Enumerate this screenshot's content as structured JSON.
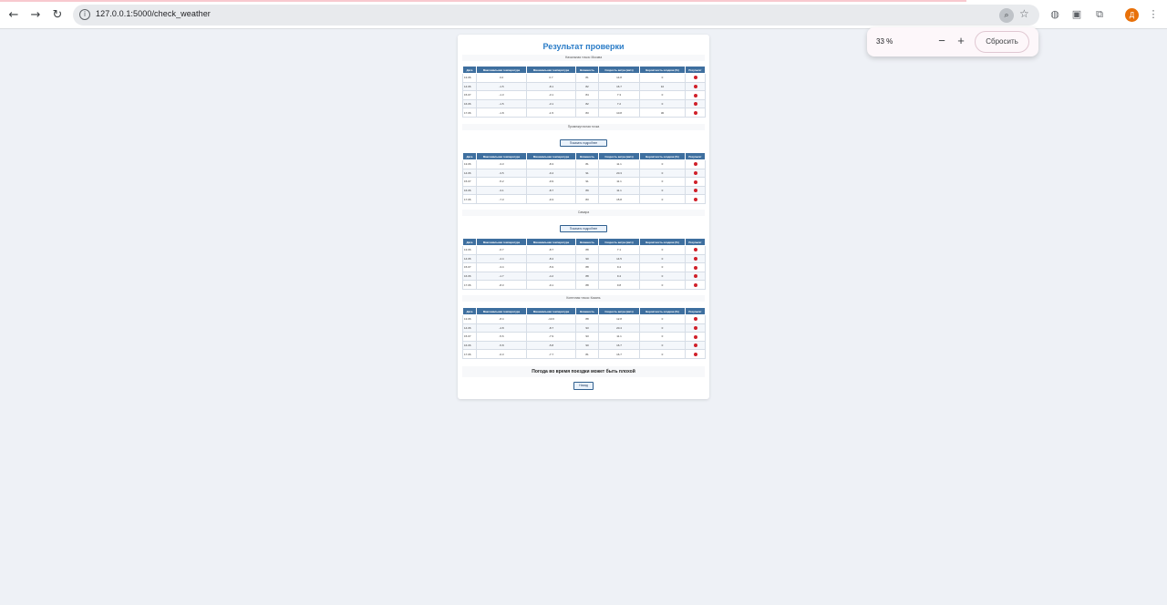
{
  "browser": {
    "url": "127.0.0.1:5000/check_weather",
    "avatar_letter": "Д",
    "zoom": {
      "value": "33 %",
      "minus": "−",
      "plus": "+",
      "reset": "Сбросить"
    }
  },
  "page": {
    "title": "Результат проверки",
    "details_button": "Показать подробнее",
    "final_message": "Погода во время поездки может быть плохой",
    "back_button": "Назад",
    "columns": [
      "Дата",
      "Максимальная температура",
      "Минимальная температура",
      "Влажность",
      "Скорость ветра (км/ч)",
      "Вероятность осадков (%)",
      "Результат"
    ],
    "points": [
      {
        "title": "Начальная точка: Москва",
        "rows": [
          {
            "date": "13.06",
            "tmax": "3.2",
            "tmin": "0.7",
            "humidity": "81",
            "wind": "14.8",
            "precip": "0"
          },
          {
            "date": "14.06",
            "tmax": "-1.5",
            "tmin": "-8.1",
            "humidity": "82",
            "wind": "16.7",
            "precip": "10"
          },
          {
            "date": "15.07",
            "tmax": "-1.3",
            "tmin": "-3.1",
            "humidity": "84",
            "wind": "7.3",
            "precip": "0"
          },
          {
            "date": "16.06",
            "tmax": "-1.5",
            "tmin": "-3.1",
            "humidity": "82",
            "wind": "7.2",
            "precip": "0"
          },
          {
            "date": "17.06",
            "tmax": "-1.8",
            "tmin": "-1.5",
            "humidity": "83",
            "wind": "10.8",
            "precip": "30"
          }
        ],
        "show_button": true
      },
      {
        "title": "Промежуточная точка",
        "rows": [
          {
            "date": "13.06",
            "tmax": "-3.3",
            "tmin": "-8.3",
            "humidity": "81",
            "wind": "11.1",
            "precip": "0"
          },
          {
            "date": "14.06",
            "tmax": "-3.5",
            "tmin": "-9.4",
            "humidity": "91",
            "wind": "20.3",
            "precip": "0"
          },
          {
            "date": "15.07",
            "tmax": "-5.2",
            "tmin": "-9.9",
            "humidity": "91",
            "wind": "11.1",
            "precip": "0"
          },
          {
            "date": "16.06",
            "tmax": "-3.1",
            "tmin": "-8.7",
            "humidity": "89",
            "wind": "11.1",
            "precip": "0"
          },
          {
            "date": "17.06",
            "tmax": "-7.3",
            "tmin": "-9.3",
            "humidity": "83",
            "wind": "15.8",
            "precip": "0"
          }
        ],
        "show_button": true
      },
      {
        "title": "Самара",
        "rows": [
          {
            "date": "13.06",
            "tmax": "-6.7",
            "tmin": "-8.7",
            "humidity": "88",
            "wind": "7.1",
            "precip": "0"
          },
          {
            "date": "14.06",
            "tmax": "-4.4",
            "tmin": "-8.4",
            "humidity": "90",
            "wind": "14.5",
            "precip": "0"
          },
          {
            "date": "15.07",
            "tmax": "-3.4",
            "tmin": "-5.9",
            "humidity": "88",
            "wind": "9.4",
            "precip": "0"
          },
          {
            "date": "16.06",
            "tmax": "-1.7",
            "tmin": "-4.2",
            "humidity": "88",
            "wind": "9.4",
            "precip": "0"
          },
          {
            "date": "17.06",
            "tmax": "-8.3",
            "tmin": "-9.1",
            "humidity": "88",
            "wind": "9.8",
            "precip": "0"
          }
        ],
        "show_button": false
      },
      {
        "title": "Конечная точка: Казань",
        "rows": [
          {
            "date": "13.06",
            "tmax": "-8.4",
            "tmin": "-10.6",
            "humidity": "88",
            "wind": "12.8",
            "precip": "0"
          },
          {
            "date": "14.06",
            "tmax": "-4.8",
            "tmin": "-8.7",
            "humidity": "93",
            "wind": "20.4",
            "precip": "0"
          },
          {
            "date": "15.07",
            "tmax": "-5.6",
            "tmin": "-7.9",
            "humidity": "93",
            "wind": "11.1",
            "precip": "0"
          },
          {
            "date": "16.06",
            "tmax": "-5.8",
            "tmin": "-5.8",
            "humidity": "90",
            "wind": "16.7",
            "precip": "0"
          },
          {
            "date": "17.06",
            "tmax": "-6.3",
            "tmin": "-7.7",
            "humidity": "81",
            "wind": "16.7",
            "precip": "0"
          }
        ],
        "show_button": false
      }
    ],
    "status_color": "#d0202a"
  }
}
